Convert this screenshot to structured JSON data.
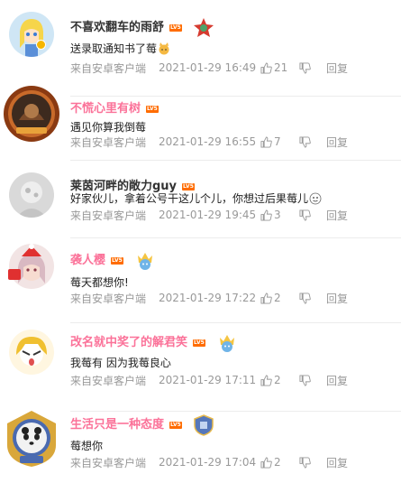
{
  "comments": [
    {
      "username": "不喜欢翻车的雨舒",
      "level": "LV5",
      "name_color": "dark",
      "badge_icon": "star-emblem-icon",
      "text": "送录取通知书了莓",
      "emoji": "cat-emoji-icon",
      "source": "来自安卓客户端",
      "time": "2021-01-29 16:49",
      "likes": "21",
      "reply_label": "回复"
    },
    {
      "username": "不慌心里有树",
      "level": "LV5",
      "name_color": "pink",
      "text": "遇见你算我倒莓",
      "source": "来自安卓客户端",
      "time": "2021-01-29 16:55",
      "likes": "7",
      "reply_label": "回复"
    },
    {
      "username": "莱茵河畔的敞力guy",
      "level": "LV5",
      "name_color": "dark",
      "text": "好家伙儿，拿着公号干这儿个儿，你想过后果莓儿",
      "emoji": "face-emoji-icon",
      "source": "来自安卓客户端",
      "time": "2021-01-29 19:45",
      "likes": "3",
      "reply_label": "回复"
    },
    {
      "username": "袭人樱",
      "level": "LV5",
      "name_color": "pink",
      "badge_icon": "crown-cat-icon",
      "text": "莓天都想你!",
      "source": "来自安卓客户端",
      "time": "2021-01-29 17:22",
      "likes": "2",
      "reply_label": "回复"
    },
    {
      "username": "改名就中奖了的解君笑",
      "level": "LV5",
      "name_color": "pink",
      "badge_icon": "crown-cat-icon",
      "text": "我莓有 因为我莓良心",
      "source": "来自安卓客户端",
      "time": "2021-01-29 17:11",
      "likes": "2",
      "reply_label": "回复"
    },
    {
      "username": "生活只是一种态度",
      "level": "LV5",
      "name_color": "pink",
      "badge_icon": "shield-emblem-icon",
      "text": "莓想你",
      "source": "来自安卓客户端",
      "time": "2021-01-29 17:04",
      "likes": "2",
      "reply_label": "回复"
    }
  ]
}
